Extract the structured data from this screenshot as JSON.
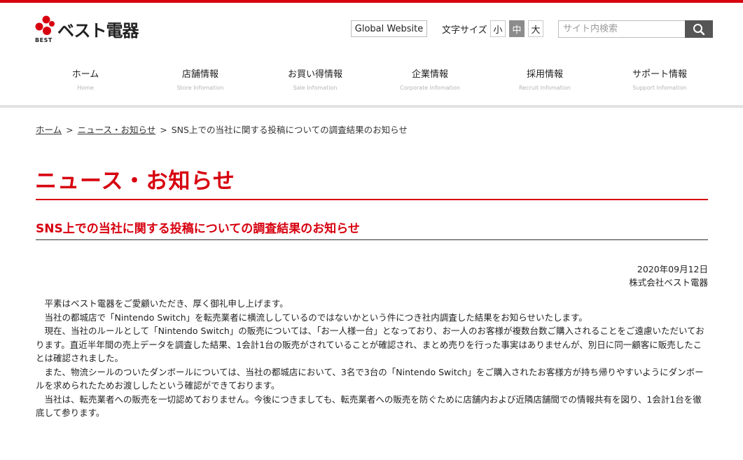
{
  "header": {
    "logo_text": "ベスト電器",
    "logo_sub": "BEST",
    "global_website": "Global Website",
    "font_size_label": "文字サイズ",
    "font_sizes": [
      "小",
      "中",
      "大"
    ],
    "font_size_selected": "中",
    "search_placeholder": "サイト内検索",
    "accent_color": "#d7000f"
  },
  "nav": [
    {
      "label": "ホーム",
      "sub": "Home"
    },
    {
      "label": "店舗情報",
      "sub": "Store Infomation"
    },
    {
      "label": "お買い得情報",
      "sub": "Sale Infomation"
    },
    {
      "label": "企業情報",
      "sub": "Corporate Infomation"
    },
    {
      "label": "採用情報",
      "sub": "Recruit Infomation"
    },
    {
      "label": "サポート情報",
      "sub": "Support Infomation"
    }
  ],
  "breadcrumb": {
    "items": [
      "ホーム",
      "ニュース・お知らせ"
    ],
    "current": "SNS上での当社に関する投稿についての調査結果のお知らせ",
    "separator": ">"
  },
  "page": {
    "title": "ニュース・お知らせ",
    "article_title": "SNS上での当社に関する投稿についての調査結果のお知らせ",
    "date": "2020年09月12日",
    "company": "株式会社ベスト電器",
    "paragraphs": [
      "平素はベスト電器をご愛顧いただき、厚く御礼申し上げます。",
      "当社の都城店で「Nintendo Switch」を転売業者に横流ししているのではないかという件につき社内調査した結果をお知らせいたします。",
      "現在、当社のルールとして「Nintendo Switch」の販売については、「お一人様一台」となっており、お一人のお客様が複数台数ご購入されることをご遠慮いただいております。直近半年間の売上データを調査した結果、1会計1台の販売がされていることが確認され、まとめ売りを行った事実はありませんが、別日に同一顧客に販売したことは確認されました。",
      "また、物流シールのついたダンボールについては、当社の都城店において、3名で3台の「Nintendo Switch」をご購入されたお客様方が持ち帰りやすいようにダンボールを求められたためお渡ししたという確認ができております。",
      "当社は、転売業者への販売を一切認めておりません。今後につきましても、転売業者への販売を防ぐために店舗内および近隣店舗間での情報共有を図り、1会計1台を徹底して参ります。"
    ]
  }
}
